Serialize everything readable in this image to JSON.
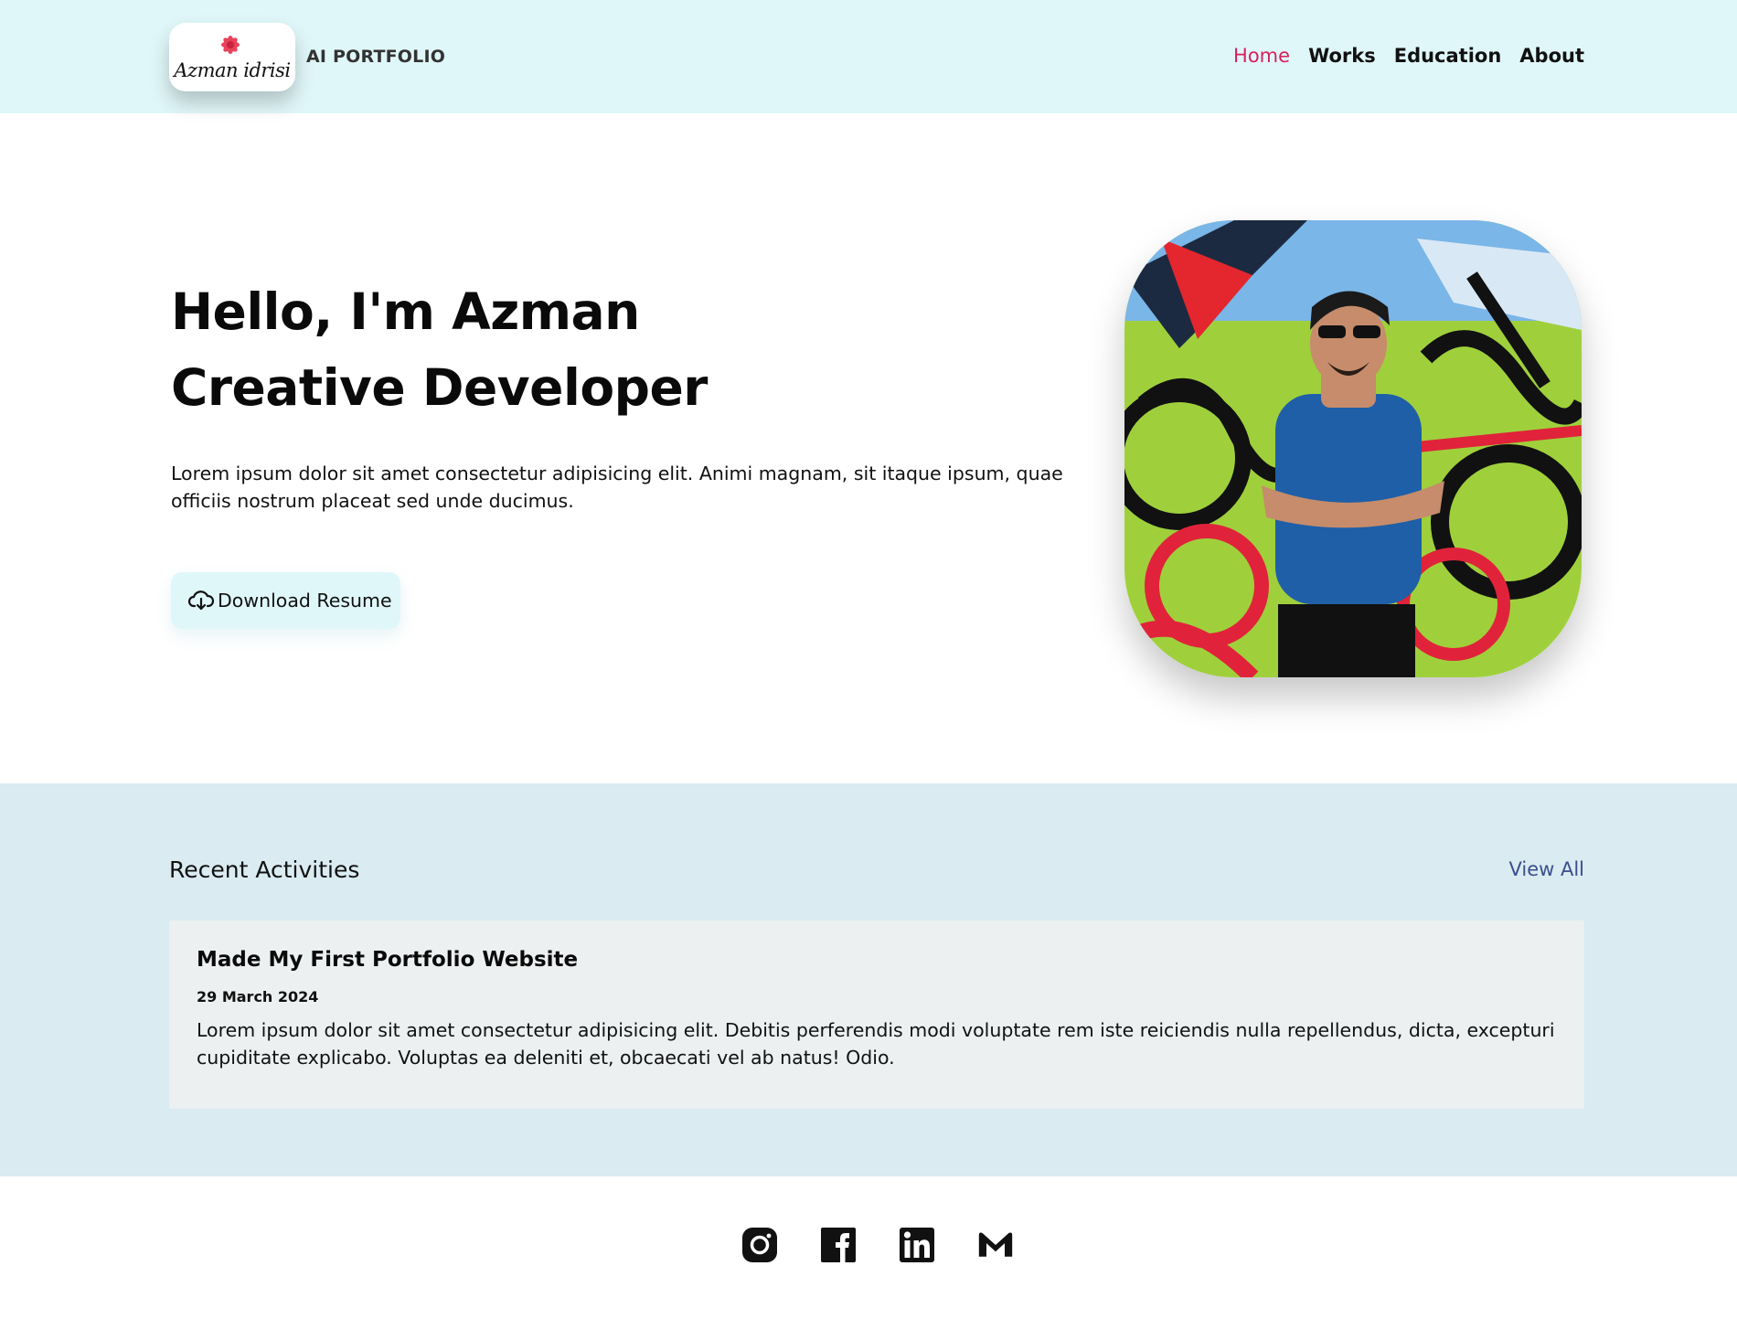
{
  "header": {
    "logo_text": "Azman idrisi",
    "brand": "AI PORTFOLIO",
    "nav": [
      "Home",
      "Works",
      "Education",
      "About"
    ],
    "active_nav": "Home"
  },
  "hero": {
    "line1": "Hello, I'm Azman",
    "line2": "Creative Developer",
    "description": "Lorem ipsum dolor sit amet consectetur adipisicing elit. Animi magnam, sit itaque ipsum, quae officiis nostrum placeat sed unde ducimus.",
    "button_label": "Download Resume",
    "button_icon": "cloud-download-icon"
  },
  "activities": {
    "title": "Recent Activities",
    "view_all": "View All",
    "items": [
      {
        "title": "Made My First Portfolio Website",
        "date": "29 March 2024",
        "text": "Lorem ipsum dolor sit amet consectetur adipisicing elit. Debitis perferendis modi voluptate rem iste reiciendis nulla repellendus, dicta, excepturi cupiditate explicabo. Voluptas ea deleniti et, obcaecati vel ab natus! Odio."
      }
    ]
  },
  "footer": {
    "socials": [
      "instagram-icon",
      "facebook-icon",
      "linkedin-icon",
      "gmail-icon"
    ]
  },
  "colors": {
    "header_bg": "#e0f7f9",
    "active_nav": "#d6215c",
    "activities_bg": "#daebf2",
    "card_bg": "#ecf0f0",
    "view_all": "#3a4f8c"
  }
}
